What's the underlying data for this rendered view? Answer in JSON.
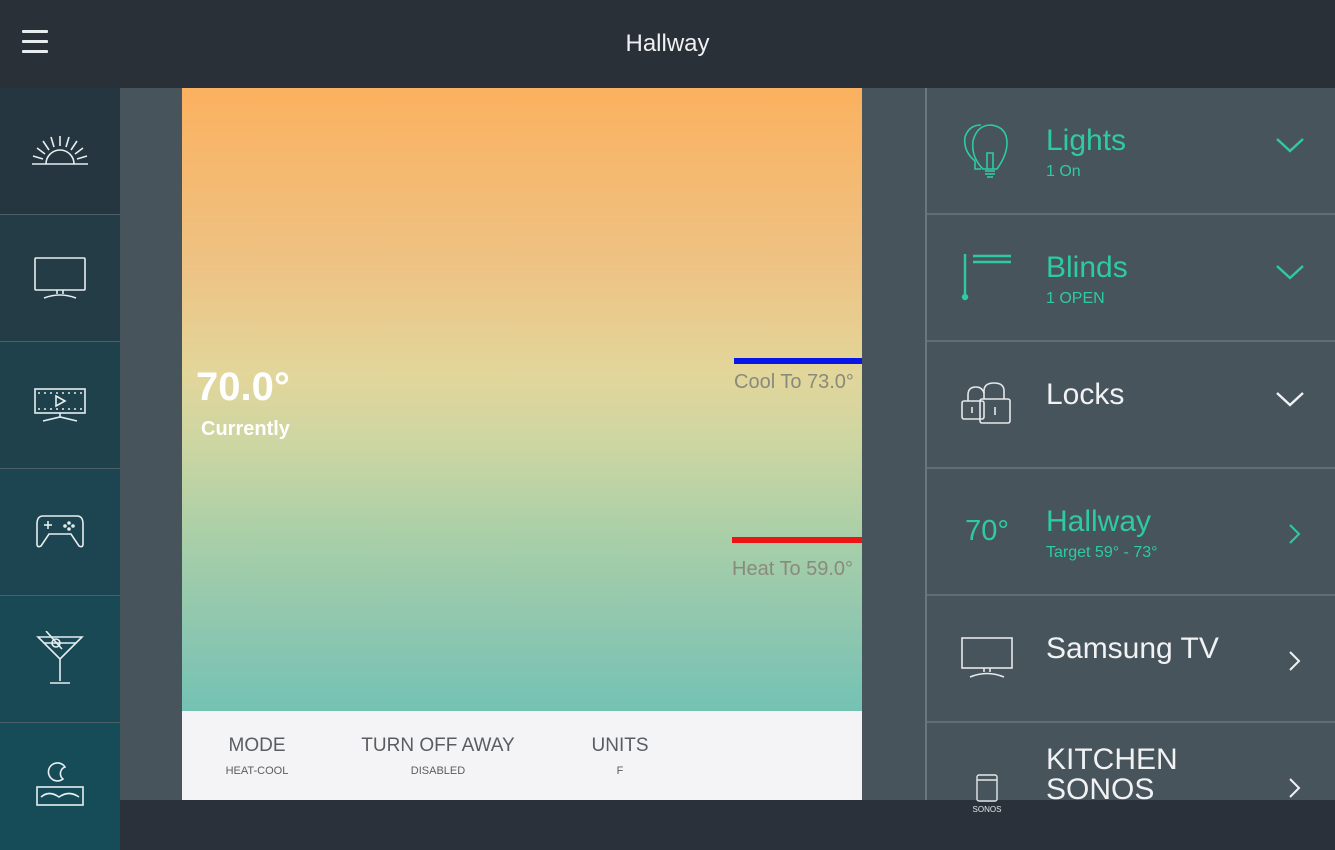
{
  "header": {
    "title": "Hallway",
    "menu_icon": "hamburger-menu-icon"
  },
  "left_nav": [
    {
      "id": "scene-sunrise",
      "icon": "sunrise-icon"
    },
    {
      "id": "scene-tv",
      "icon": "tv-icon"
    },
    {
      "id": "scene-movie",
      "icon": "movie-screen-icon"
    },
    {
      "id": "scene-gaming",
      "icon": "gamepad-icon"
    },
    {
      "id": "scene-party",
      "icon": "martini-icon"
    },
    {
      "id": "scene-sleep",
      "icon": "bed-moon-icon"
    }
  ],
  "thermostat": {
    "current_temp": "70.0°",
    "current_label": "Currently",
    "cool_to_label": "Cool To  73.0°",
    "heat_to_label": "Heat To  59.0°",
    "cool_setpoint": 73.0,
    "heat_setpoint": 59.0,
    "colors": {
      "cool": "#0a16e6",
      "heat": "#ec1414"
    },
    "settings": [
      {
        "label": "MODE",
        "value": "HEAT-COOL"
      },
      {
        "label": "TURN OFF AWAY",
        "value": "DISABLED"
      },
      {
        "label": "UNITS",
        "value": "F"
      }
    ]
  },
  "devices": [
    {
      "name": "Lights",
      "sub": "1  On",
      "icon": "lightbulbs-icon",
      "action": "expand",
      "active": true
    },
    {
      "name": "Blinds",
      "sub": "1 OPEN",
      "icon": "blinds-icon",
      "action": "expand",
      "active": true
    },
    {
      "name": "Locks",
      "sub": "",
      "icon": "padlocks-icon",
      "action": "expand",
      "active": false
    },
    {
      "name": "Hallway",
      "sub": "Target  59° - 73°",
      "icon_text": "70°",
      "icon": "thermostat-temp",
      "action": "navigate",
      "active": true
    },
    {
      "name": "Samsung TV",
      "sub": "",
      "icon": "tv-icon",
      "action": "navigate",
      "active": false
    },
    {
      "name": "KITCHEN SONOS",
      "sub": "",
      "icon": "sonos-speaker-icon",
      "icon_caption": "SONOS",
      "action": "navigate",
      "active": false
    }
  ],
  "accent_color": "#2ecba0"
}
